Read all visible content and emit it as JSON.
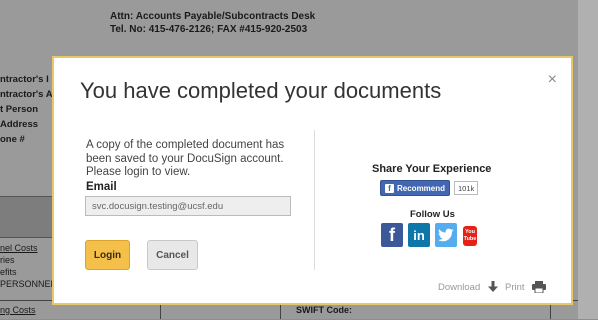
{
  "background": {
    "attn_lines": [
      "Attn: Accounts Payable/Subcontracts Desk",
      "Tel. No: 415-476-2126; FAX #415-920-2503"
    ],
    "left_labels": [
      "ntractor's I",
      "ntractor's A",
      "t Person",
      "Address",
      "one #"
    ],
    "cost_lines": [
      "nel Costs",
      "ries",
      "efits",
      "PERSONNEL"
    ],
    "bottom_left": "ng Costs",
    "bottom_swift": "SWIFT Code:"
  },
  "modal": {
    "title": "You have completed your documents",
    "close_glyph": "×",
    "message": "A copy of the completed document has been saved to your DocuSign account. Please login to view.",
    "email_label": "Email",
    "email_value": "svc.docusign.testing@ucsf.edu",
    "login_label": "Login",
    "cancel_label": "Cancel",
    "share_heading": "Share Your Experience",
    "recommend_label": "Recommend",
    "recommend_count": "101k",
    "follow_heading": "Follow Us",
    "download_label": "Download",
    "print_label": "Print"
  },
  "social_icons": [
    "facebook-icon",
    "linkedin-icon",
    "twitter-icon",
    "youtube-icon"
  ],
  "colors": {
    "modal_border": "#e8c66a",
    "login_button": "#f4c04a",
    "facebook": "#3b5998",
    "linkedin": "#0e76a8",
    "twitter": "#55acee",
    "youtube": "#e62117"
  }
}
